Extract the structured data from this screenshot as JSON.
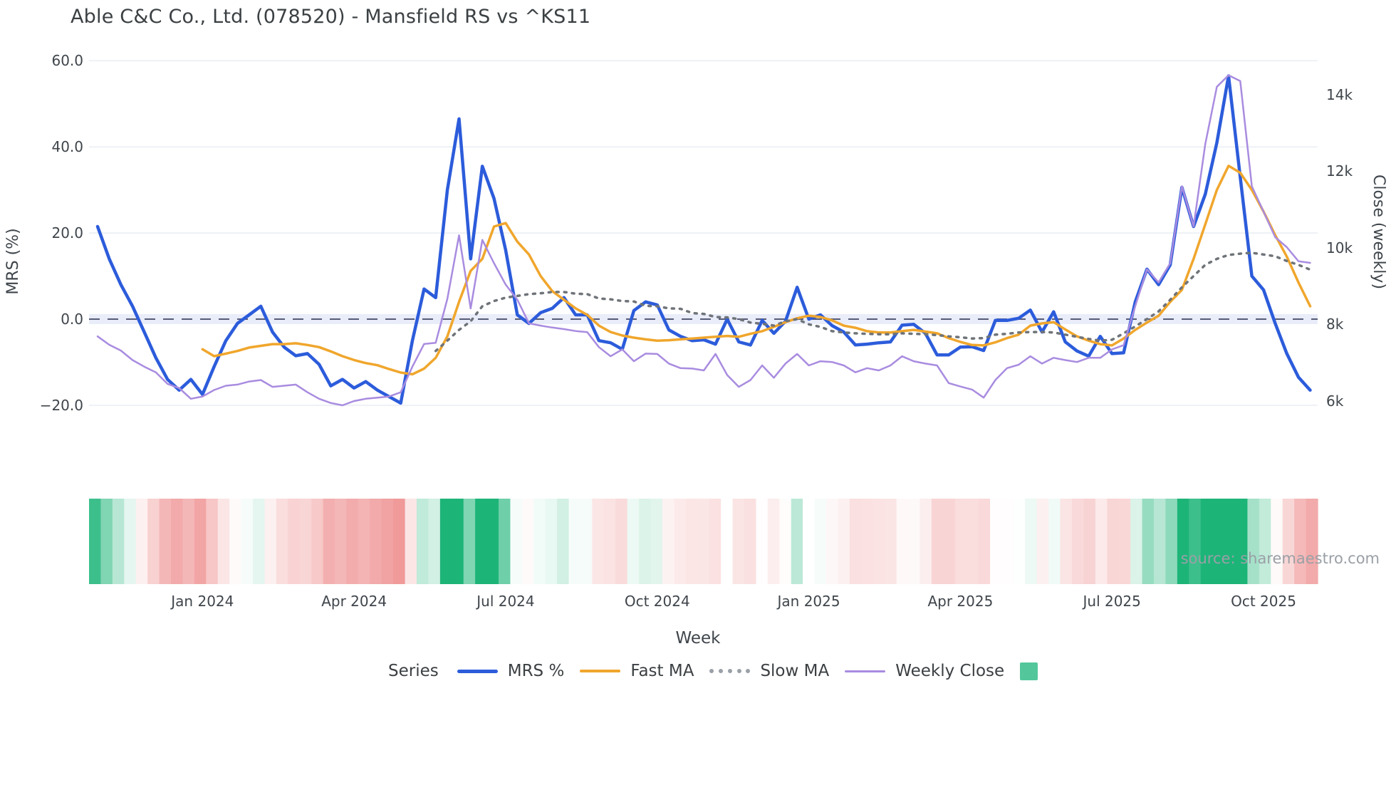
{
  "title": "Able C&C Co., Ltd. (078520) - Mansfield RS vs ^KS11",
  "source_note": "source: sharemaestro.com",
  "axes": {
    "left_label": "MRS (%)",
    "right_label": "Close (weekly)",
    "x_label": "Week",
    "left_ticks": [
      {
        "label": "60.0",
        "value": 60
      },
      {
        "label": "40.0",
        "value": 40
      },
      {
        "label": "20.0",
        "value": 20
      },
      {
        "label": "0.0",
        "value": 0
      },
      {
        "label": "−20.0",
        "value": -20
      }
    ],
    "right_ticks": [
      {
        "label": "14k",
        "value": 14
      },
      {
        "label": "12k",
        "value": 12
      },
      {
        "label": "10k",
        "value": 10
      },
      {
        "label": "8k",
        "value": 8
      },
      {
        "label": "6k",
        "value": 6
      }
    ],
    "x_ticks": [
      {
        "label": "Jan 2024",
        "week": 9
      },
      {
        "label": "Apr 2024",
        "week": 22
      },
      {
        "label": "Jul 2024",
        "week": 35
      },
      {
        "label": "Oct 2024",
        "week": 48
      },
      {
        "label": "Jan 2025",
        "week": 61
      },
      {
        "label": "Apr 2025",
        "week": 74
      },
      {
        "label": "Jul 2025",
        "week": 87
      },
      {
        "label": "Oct 2025",
        "week": 100
      }
    ]
  },
  "legend": {
    "title": "Series",
    "items": [
      {
        "label": "MRS %",
        "swatch": "line",
        "color": "#2c5cdb",
        "thickness": 5
      },
      {
        "label": "Fast MA",
        "swatch": "line",
        "color": "#f0a62c",
        "thickness": 4
      },
      {
        "label": "Slow MA",
        "swatch": "dots",
        "color": "#9aa0a6",
        "thickness": 4
      },
      {
        "label": "Weekly Close",
        "swatch": "line",
        "color": "#a98ce0",
        "thickness": 3
      },
      {
        "label": "",
        "swatch": "square",
        "color": "#53c79b",
        "thickness": 25
      }
    ]
  },
  "chart_data": {
    "type": "line",
    "title": "Able C&C Co., Ltd. (078520) - Mansfield RS vs ^KS11",
    "xlabel": "Week",
    "ylabel_left": "MRS (%)",
    "ylabel_right": "Close (weekly)",
    "x_start_date": "2023-10-30",
    "x_frequency": "weekly",
    "weeks": 105,
    "ylim_left": [
      -25,
      62
    ],
    "ylim_right_k": [
      5.5,
      15
    ],
    "grid": "horizontal-only",
    "zero_line": {
      "value": 0,
      "style": "dashed",
      "color": "#575c78"
    },
    "legend_position": "bottom-center",
    "series": [
      {
        "name": "MRS %",
        "axis": "left",
        "unit": "%",
        "color": "#2c5cdb",
        "style": "solid",
        "width": 4.5,
        "values": [
          21.5,
          14,
          8,
          3,
          -3,
          -9,
          -14,
          -16.5,
          -14,
          -17.5,
          -11,
          -5,
          -1,
          1,
          3,
          -3,
          -6.5,
          -8.5,
          -8,
          -10.5,
          -15.5,
          -14,
          -16,
          -14.5,
          -16.5,
          -18,
          -19.5,
          -5,
          7,
          5,
          30,
          46.5,
          14,
          35.5,
          28,
          16,
          1,
          -1,
          1.5,
          2.5,
          5,
          1,
          1,
          -5,
          -5.5,
          -7,
          2,
          4,
          3.3,
          -2.5,
          -4,
          -5,
          -4.8,
          -5.8,
          0,
          -5.3,
          -6,
          -0.3,
          -3.3,
          -0.5,
          7.4,
          0,
          1,
          -1.5,
          -3,
          -6,
          -5.8,
          -5.5,
          -5.3,
          -1.4,
          -1.2,
          -3.3,
          -8.3,
          -8.3,
          -6.5,
          -6.4,
          -7.3,
          -0.3,
          -0.3,
          0.2,
          2.1,
          -3,
          1.7,
          -5.3,
          -7.4,
          -8.6,
          -4,
          -8,
          -7.8,
          4,
          11.6,
          8,
          12.6,
          30.6,
          21.5,
          29,
          41,
          56.5,
          33,
          10,
          6.8,
          -1,
          -8,
          -13.5,
          -16.5
        ]
      },
      {
        "name": "Fast MA",
        "axis": "left",
        "unit": "%",
        "color": "#f0a62c",
        "style": "solid",
        "width": 3.5,
        "values": [
          null,
          null,
          null,
          null,
          null,
          null,
          null,
          null,
          null,
          -7,
          -8.6,
          -8,
          -7.4,
          -6.6,
          -6.2,
          -5.8,
          -5.8,
          -5.6,
          -6,
          -6.5,
          -7.5,
          -8.6,
          -9.5,
          -10.2,
          -10.7,
          -11.6,
          -12.4,
          -12.8,
          -11.5,
          -9,
          -4,
          4,
          11.2,
          14,
          21.5,
          22.3,
          18,
          15,
          10,
          6.5,
          4.5,
          2.5,
          1,
          -1.5,
          -3,
          -3.8,
          -4.3,
          -4.7,
          -5,
          -4.9,
          -4.7,
          -4.5,
          -4.3,
          -4.1,
          -3.9,
          -4.1,
          -3.4,
          -2.8,
          -1.8,
          -0.7,
          0.2,
          0.8,
          0.5,
          -0.3,
          -1.5,
          -2,
          -2.8,
          -3.1,
          -3.1,
          -2.8,
          -2.5,
          -2.9,
          -3.3,
          -4.4,
          -5.3,
          -6,
          -6.1,
          -5.4,
          -4.4,
          -3.6,
          -1.5,
          -1,
          -0.7,
          -2.4,
          -4,
          -5,
          -5.8,
          -6.1,
          -4.5,
          -2.5,
          -0.8,
          0.8,
          4,
          6.8,
          14,
          22,
          30,
          35.6,
          34,
          30,
          25,
          19.5,
          14.5,
          8.5,
          3
        ]
      },
      {
        "name": "Slow MA",
        "axis": "left",
        "unit": "%",
        "color": "#6f7479",
        "style": "dotted",
        "width": 3.5,
        "values": [
          null,
          null,
          null,
          null,
          null,
          null,
          null,
          null,
          null,
          null,
          null,
          null,
          null,
          null,
          null,
          null,
          null,
          null,
          null,
          null,
          null,
          null,
          null,
          null,
          null,
          null,
          null,
          null,
          null,
          -7.4,
          -5,
          -2.5,
          -0.5,
          3,
          4.2,
          5,
          5.4,
          5.8,
          6,
          6.3,
          6.3,
          5.9,
          5.8,
          4.8,
          4.6,
          4.2,
          4.1,
          3.1,
          3,
          2.5,
          2.4,
          1.4,
          1.2,
          0.5,
          0.4,
          0,
          -0.8,
          -1.1,
          -1.5,
          -0.5,
          0,
          -1.2,
          -1.8,
          -2.8,
          -3.1,
          -3.3,
          -3.4,
          -3.5,
          -3.5,
          -3.3,
          -3.4,
          -3.5,
          -3.7,
          -4,
          -4.2,
          -4.5,
          -4.4,
          -3.6,
          -3.4,
          -3.1,
          -3,
          -3,
          -3.1,
          -3.6,
          -4.1,
          -4.6,
          -5,
          -4.8,
          -3.3,
          -1.7,
          0,
          1.8,
          4.5,
          7.4,
          10,
          12.6,
          14,
          14.9,
          15.2,
          15.4,
          15,
          14.6,
          13.5,
          12.6,
          11.5
        ]
      },
      {
        "name": "Weekly Close",
        "axis": "right",
        "unit": "k",
        "color": "#a98ce0",
        "style": "solid",
        "width": 2.5,
        "values": [
          7.68,
          7.46,
          7.31,
          7.06,
          6.89,
          6.74,
          6.44,
          6.33,
          6.05,
          6.11,
          6.28,
          6.39,
          6.42,
          6.5,
          6.54,
          6.36,
          6.39,
          6.42,
          6.22,
          6.05,
          5.94,
          5.88,
          5.99,
          6.05,
          6.08,
          6.11,
          6.22,
          6.89,
          7.48,
          7.51,
          8.66,
          10.32,
          8.41,
          10.2,
          9.59,
          9.03,
          8.64,
          8.02,
          7.96,
          7.91,
          7.87,
          7.82,
          7.79,
          7.4,
          7.16,
          7.34,
          7.03,
          7.23,
          7.22,
          6.97,
          6.85,
          6.84,
          6.79,
          7.22,
          6.67,
          6.36,
          6.54,
          6.92,
          6.6,
          6.97,
          7.22,
          6.92,
          7.03,
          7.01,
          6.92,
          6.74,
          6.85,
          6.79,
          6.92,
          7.16,
          7.03,
          6.97,
          6.92,
          6.46,
          6.37,
          6.29,
          6.08,
          6.54,
          6.85,
          6.94,
          7.16,
          6.97,
          7.12,
          7.06,
          7.01,
          7.12,
          7.12,
          7.34,
          7.45,
          8.47,
          9.43,
          9.09,
          9.59,
          11.6,
          10.55,
          12.7,
          14.2,
          14.5,
          14.35,
          11.6,
          10.94,
          10.27,
          10.01,
          9.64,
          9.6
        ]
      }
    ],
    "heatmap_strip": {
      "derived_from": "MRS %",
      "rule": "green when MRS positive, red when negative, intensity proportional to |MRS| capped at 25",
      "positive_color": "#1db478",
      "negative_color": "#ec7e7e",
      "cells": 105
    }
  }
}
